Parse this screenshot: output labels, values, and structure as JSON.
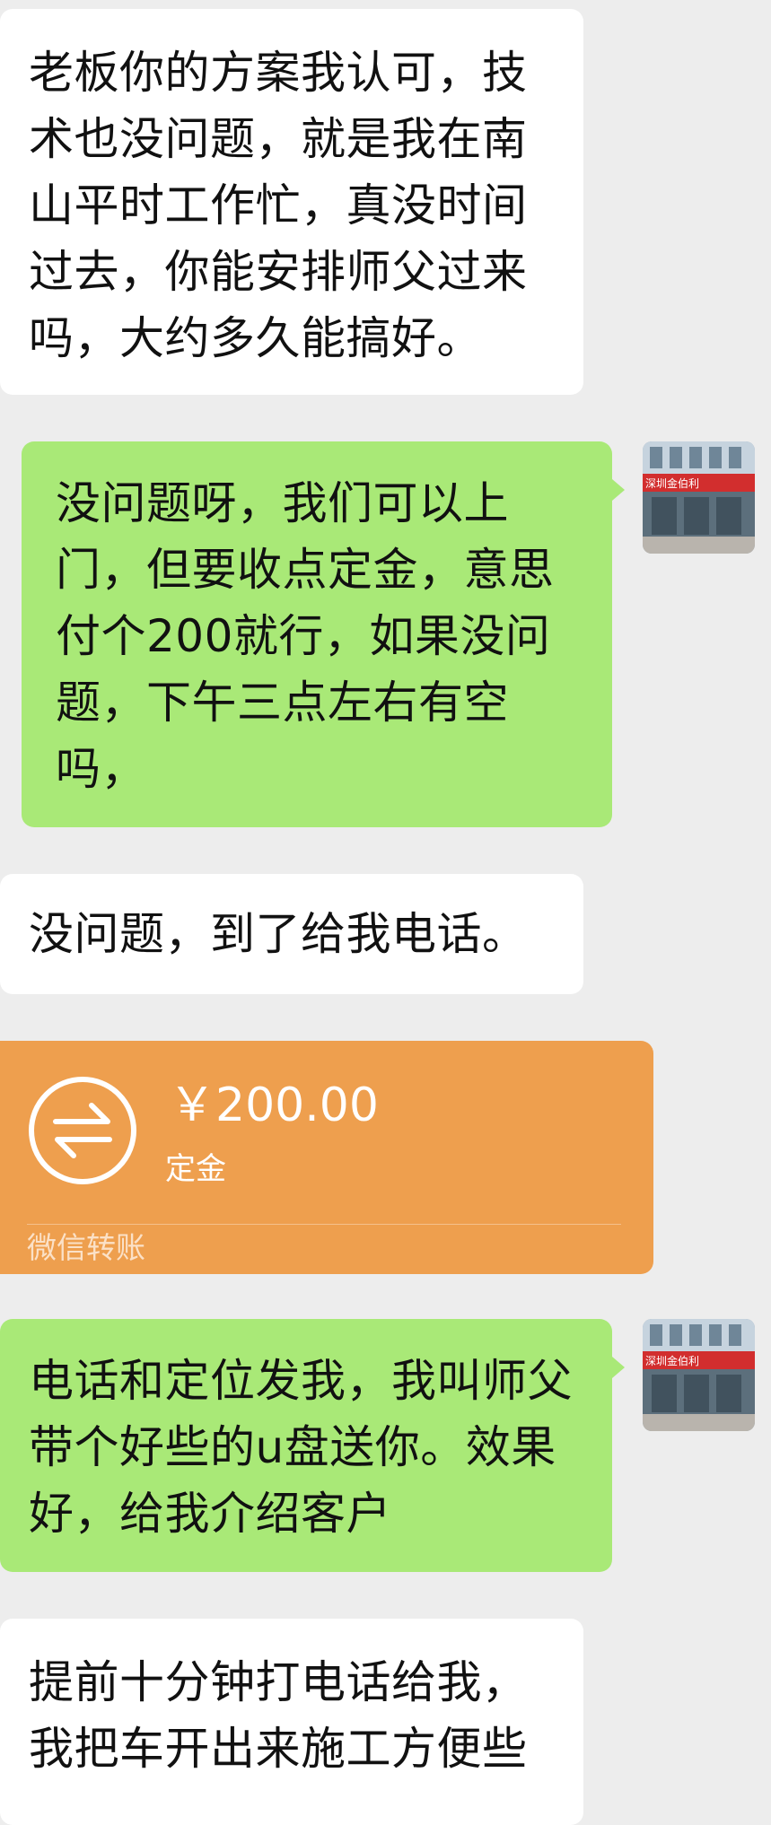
{
  "messages": [
    {
      "text": "老板你的方案我认可，技术也没问题，就是我在南山平时工作忙，真没时间过去，你能安排师父过来吗，大约多久能搞好。"
    },
    {
      "text": "没问题呀，我们可以上门，但要收点定金，意思付个200就行，如果没问题，下午三点左右有空吗，"
    },
    {
      "text": "没问题，到了给我电话。"
    },
    {
      "text": "电话和定位发我，我叫师父带个好些的u盘送你。效果好，给我介绍客户"
    },
    {
      "text": "提前十分钟打电话给我，我把车开出来施工方便些"
    }
  ],
  "transfer": {
    "amount": "￥200.00",
    "note": "定金",
    "footer": "微信转账",
    "icon": "transfer-arrows-icon",
    "color": "#ee9f4e"
  },
  "avatar": {
    "icon": "storefront-avatar",
    "sign_text": "深圳金伯利"
  },
  "colors": {
    "background": "#ededed",
    "incoming_bubble": "#ffffff",
    "outgoing_bubble": "#a9e977"
  }
}
